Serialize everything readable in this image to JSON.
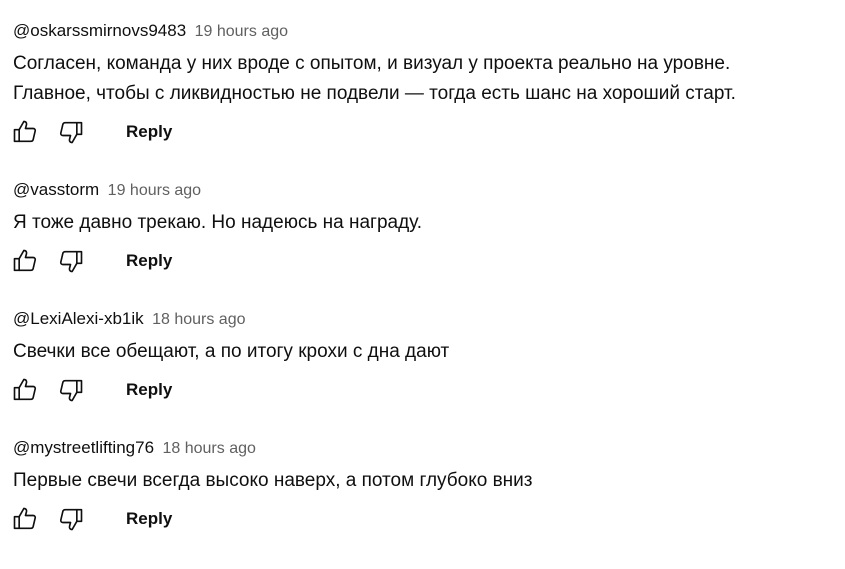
{
  "comments": [
    {
      "author": "@oskarssmirnovs9483",
      "time": "19 hours ago",
      "lines": [
        "Согласен, команда у них вроде с опытом, и визуал у проекта реально на уровне.",
        "Главное, чтобы с ликвидностью не подвели — тогда есть шанс на хороший старт."
      ],
      "reply_label": "Reply"
    },
    {
      "author": "@vasstorm",
      "time": "19 hours ago",
      "lines": [
        "Я тоже давно трекаю. Но надеюсь на награду."
      ],
      "reply_label": "Reply"
    },
    {
      "author": "@LexiAlexi-xb1ik",
      "time": "18 hours ago",
      "lines": [
        "Свечки все обещают, а по итогу крохи с дна дают"
      ],
      "reply_label": "Reply"
    },
    {
      "author": "@mystreetlifting76",
      "time": "18 hours ago",
      "lines": [
        "Первые свечи всегда высоко наверх, а потом глубоко вниз"
      ],
      "reply_label": "Reply"
    }
  ],
  "icons": {
    "like": "thumbs-up-icon",
    "dislike": "thumbs-down-icon"
  }
}
